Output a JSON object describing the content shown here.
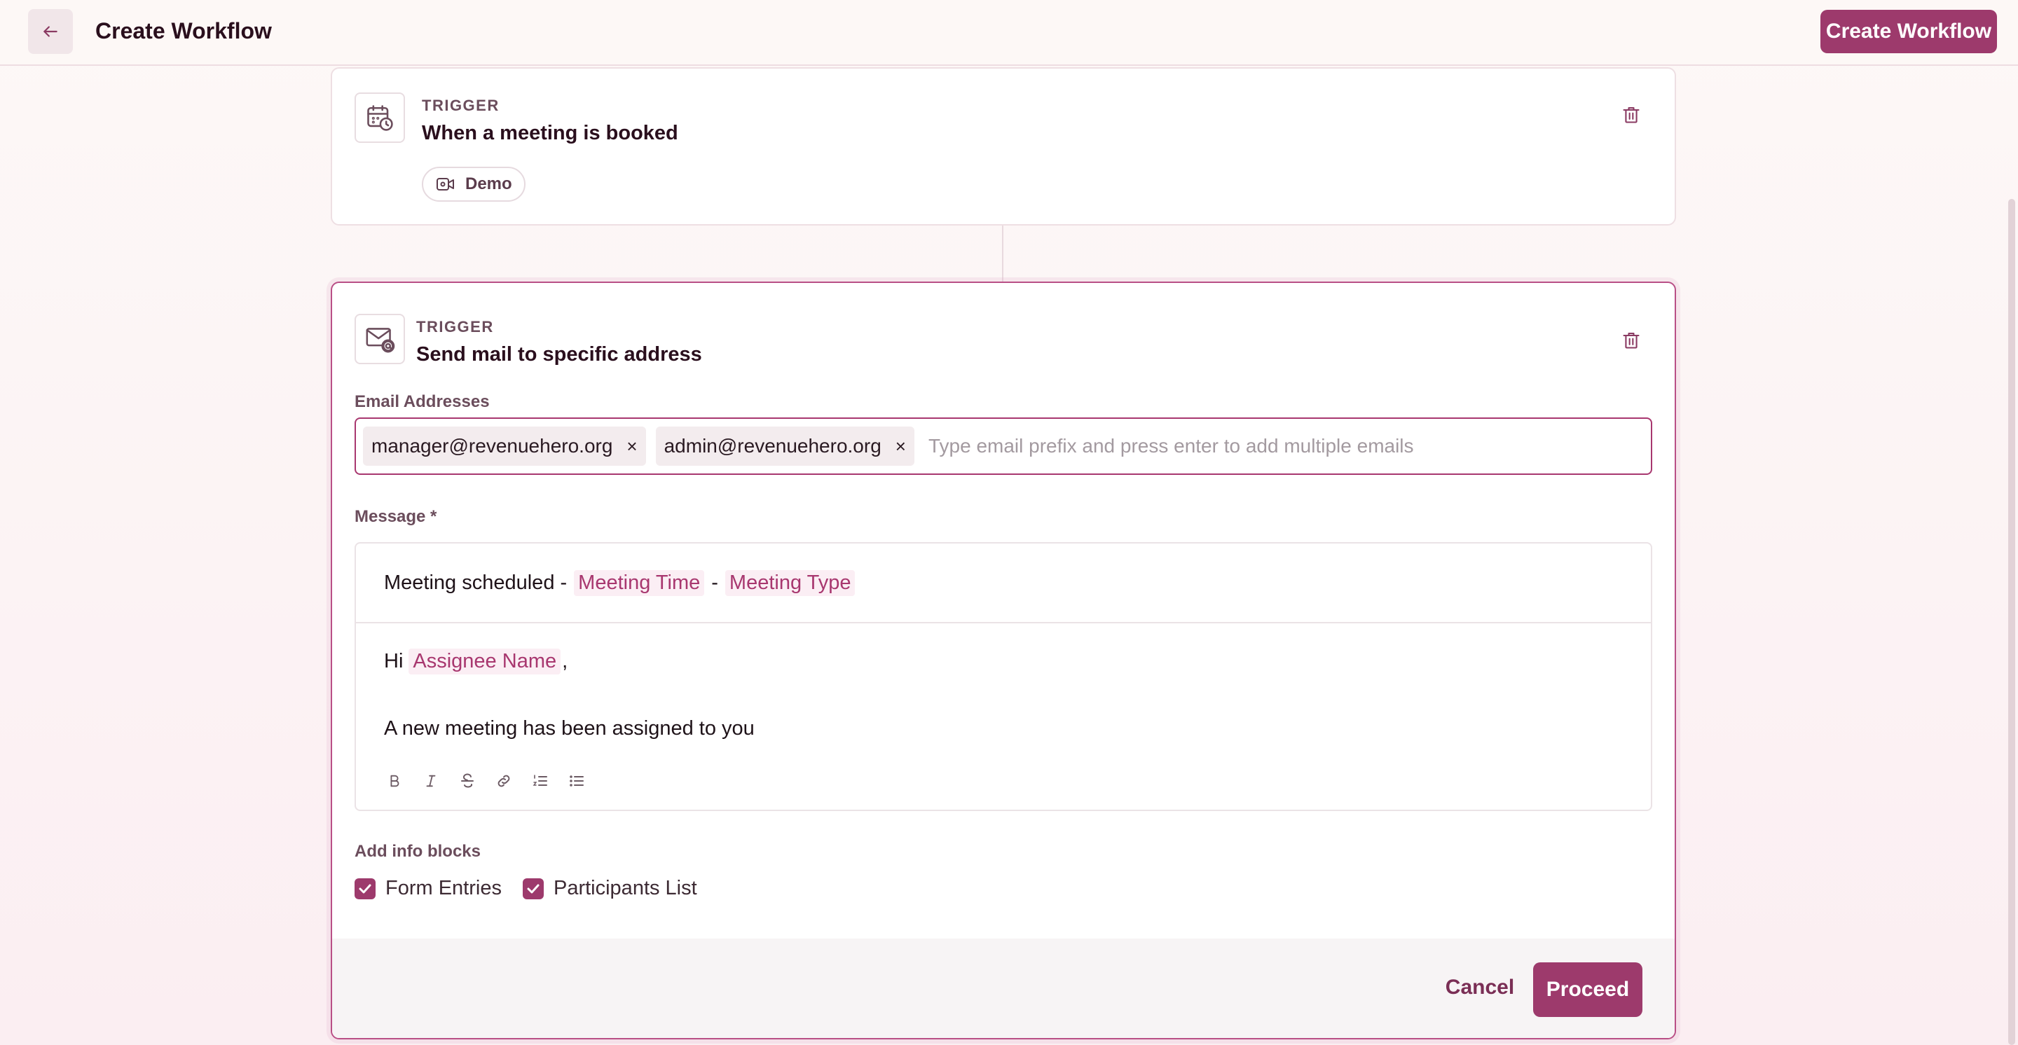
{
  "header": {
    "title": "Create Workflow",
    "create_button": "Create Workflow"
  },
  "trigger_card": {
    "label": "TRIGGER",
    "title": "When a meeting is booked",
    "chip": "Demo"
  },
  "action_card": {
    "label": "TRIGGER",
    "title": "Send mail to specific address",
    "email_label": "Email Addresses",
    "emails": [
      "manager@revenuehero.org",
      "admin@revenuehero.org"
    ],
    "email_placeholder": "Type email prefix and press enter to add multiple emails",
    "message_label": "Message *",
    "subject": {
      "text": "Meeting scheduled -",
      "token1": "Meeting Time",
      "sep": "-",
      "token2": "Meeting Type"
    },
    "body": {
      "greeting": "Hi",
      "token": "Assignee Name",
      "comma": ",",
      "line2": "A new meeting has been assigned to you"
    },
    "info_blocks_label": "Add info blocks",
    "info_blocks": [
      {
        "label": "Form Entries",
        "checked": true
      },
      {
        "label": "Participants List",
        "checked": true
      }
    ],
    "cancel": "Cancel",
    "proceed": "Proceed"
  },
  "colors": {
    "accent": "#9d3a6c",
    "token_bg": "#fbeef4",
    "border": "#eedfe3"
  }
}
